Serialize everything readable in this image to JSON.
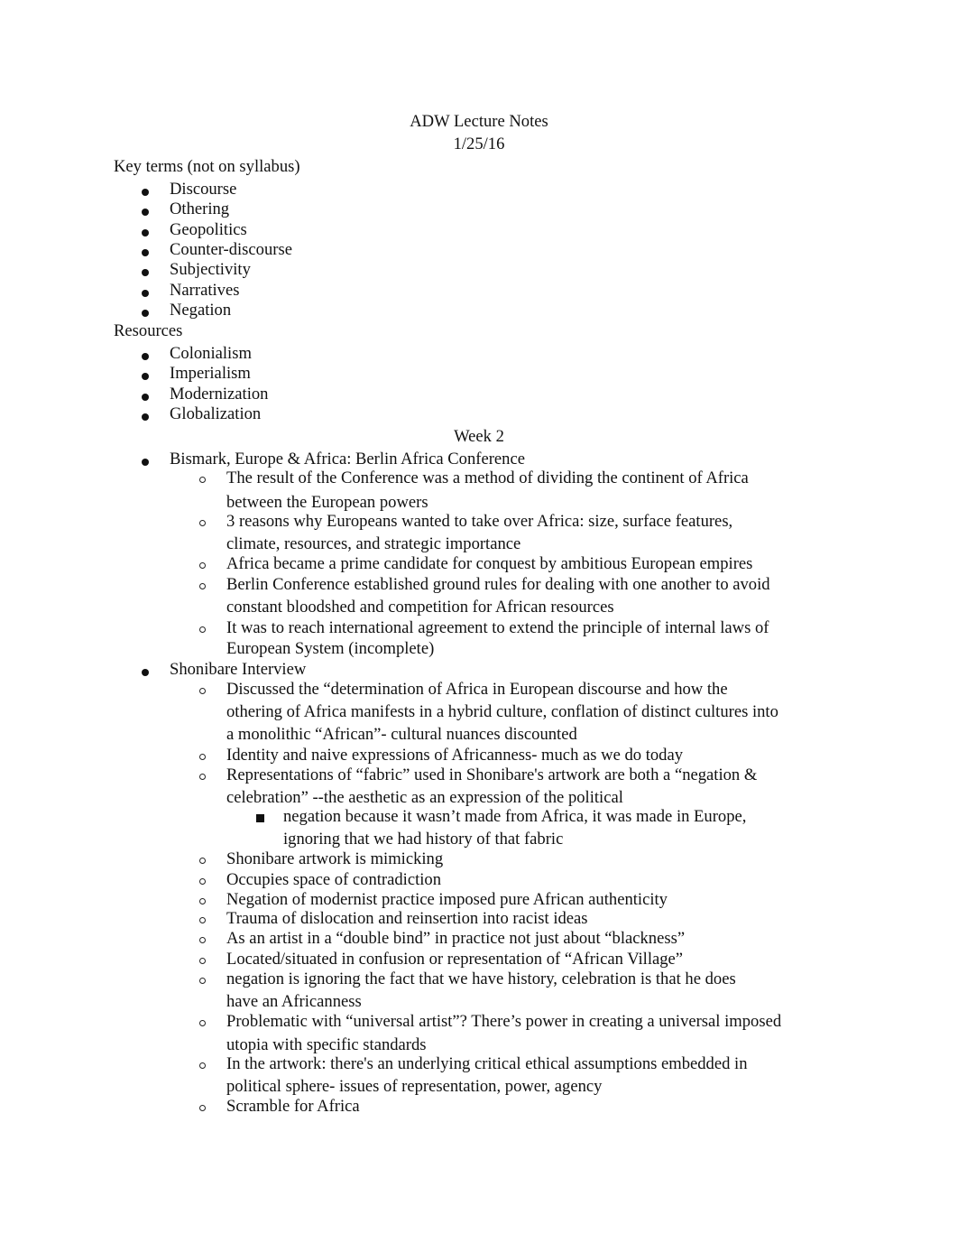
{
  "header": {
    "title": "ADW Lecture Notes",
    "date": "1/25/16"
  },
  "key_terms": {
    "heading": "Key terms (not on syllabus)",
    "items": [
      "Discourse",
      "Othering",
      "Geopolitics",
      "Counter-discourse",
      "Subjectivity",
      "Narratives",
      "Negation"
    ]
  },
  "resources": {
    "heading": "Resources",
    "items": [
      "Colonialism",
      "Imperialism",
      "Modernization",
      "Globalization"
    ]
  },
  "week": {
    "heading": "Week 2",
    "topics": [
      {
        "title": "Bismark, Europe & Africa: Berlin Africa Conference",
        "points": [
          [
            "The result of the Conference was a method of dividing the continent of Africa",
            "between the European powers"
          ],
          [
            "3 reasons why Europeans wanted to take over Africa: size, surface features,",
            "climate, resources, and strategic importance"
          ],
          [
            "Africa became a prime candidate for conquest by ambitious European empires"
          ],
          [
            "Berlin Conference established ground rules for dealing with one another to avoid",
            "constant bloodshed and competition for African resources"
          ],
          [
            "It was to reach international agreement to extend the principle of internal laws of",
            "European System (incomplete)"
          ]
        ]
      },
      {
        "title": "Shonibare Interview",
        "points": [
          [
            "Discussed the “determination of Africa in European discourse and how the",
            "othering of Africa manifests in a hybrid culture, conflation of distinct cultures into",
            "a monolithic “African”- cultural nuances discounted"
          ],
          [
            "Identity and naive expressions of Africanness- much as we do today"
          ],
          [
            "Representations of “fabric” used in Shonibare's artwork are both a “negation &",
            "celebration” --the aesthetic as an expression of the political"
          ],
          [
            "Shonibare artwork is mimicking"
          ],
          [
            "Occupies space of contradiction"
          ],
          [
            "Negation of modernist practice imposed pure African authenticity"
          ],
          [
            "Trauma of dislocation and reinsertion into racist ideas"
          ],
          [
            "As an artist in a “double bind” in practice not just about “blackness”"
          ],
          [
            "Located/situated in confusion or representation of “African Village”"
          ],
          [
            "negation is ignoring the fact that we have history, celebration is that he does",
            "have an Africanness"
          ],
          [
            "Problematic with “universal artist”? There’s power in creating a universal imposed",
            "utopia with specific standards"
          ],
          [
            "In the artwork: there's an underlying critical ethical assumptions embedded in",
            "political sphere- issues of representation, power, agency"
          ],
          [
            "Scramble for Africa"
          ]
        ],
        "subpoint": [
          "negation because it wasn’t made from Africa, it was made in Europe,",
          "ignoring that we had history of that fabric"
        ]
      }
    ]
  }
}
